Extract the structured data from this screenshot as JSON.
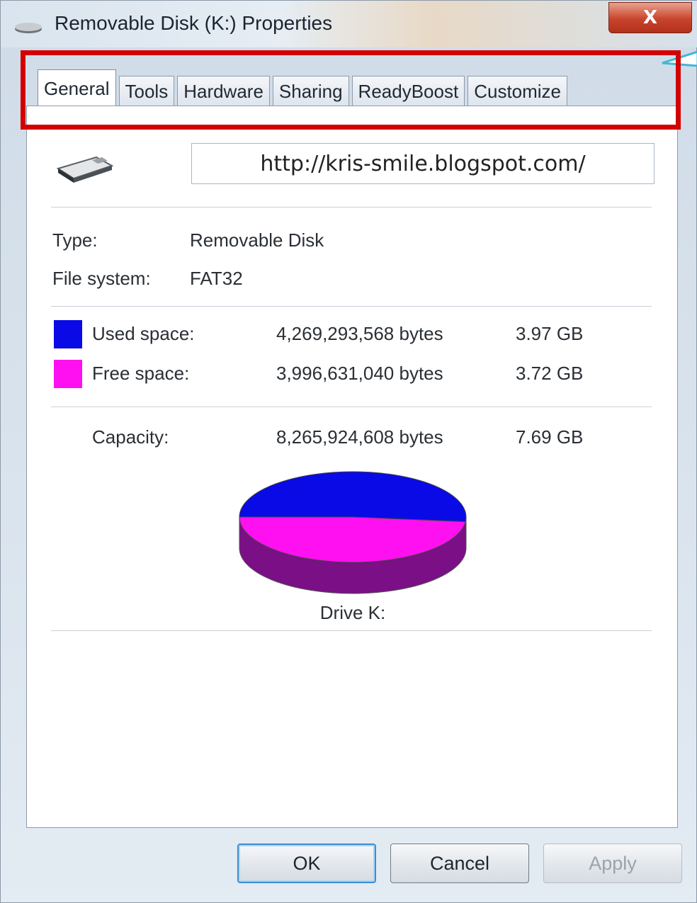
{
  "window": {
    "title": "Removable Disk (K:) Properties",
    "close_glyph": "X"
  },
  "tabs": [
    {
      "label": "General",
      "active": true
    },
    {
      "label": "Tools",
      "active": false
    },
    {
      "label": "Hardware",
      "active": false
    },
    {
      "label": "Sharing",
      "active": false
    },
    {
      "label": "ReadyBoost",
      "active": false
    },
    {
      "label": "Customize",
      "active": false
    }
  ],
  "general": {
    "volume_name": "http://kris-smile.blogspot.com/",
    "type_label": "Type:",
    "type_value": "Removable Disk",
    "fs_label": "File system:",
    "fs_value": "FAT32",
    "used": {
      "label": "Used space:",
      "bytes": "4,269,293,568 bytes",
      "size": "3.97 GB",
      "color": "#0a0ae6"
    },
    "free": {
      "label": "Free space:",
      "bytes": "3,996,631,040 bytes",
      "size": "3.72 GB",
      "color": "#ff10f0"
    },
    "capacity": {
      "label": "Capacity:",
      "bytes": "8,265,924,608 bytes",
      "size": "7.69 GB"
    },
    "drive_label": "Drive K:"
  },
  "chart_data": {
    "type": "pie",
    "slices": [
      {
        "label": "Used space",
        "value": 4269293568,
        "color": "#0a0ae6"
      },
      {
        "label": "Free space",
        "value": 3996631040,
        "color": "#ff10f0"
      }
    ]
  },
  "buttons": {
    "ok": "OK",
    "cancel": "Cancel",
    "apply": "Apply"
  },
  "icons": {
    "title": "drive-icon",
    "drive": "usb-drive-icon"
  }
}
